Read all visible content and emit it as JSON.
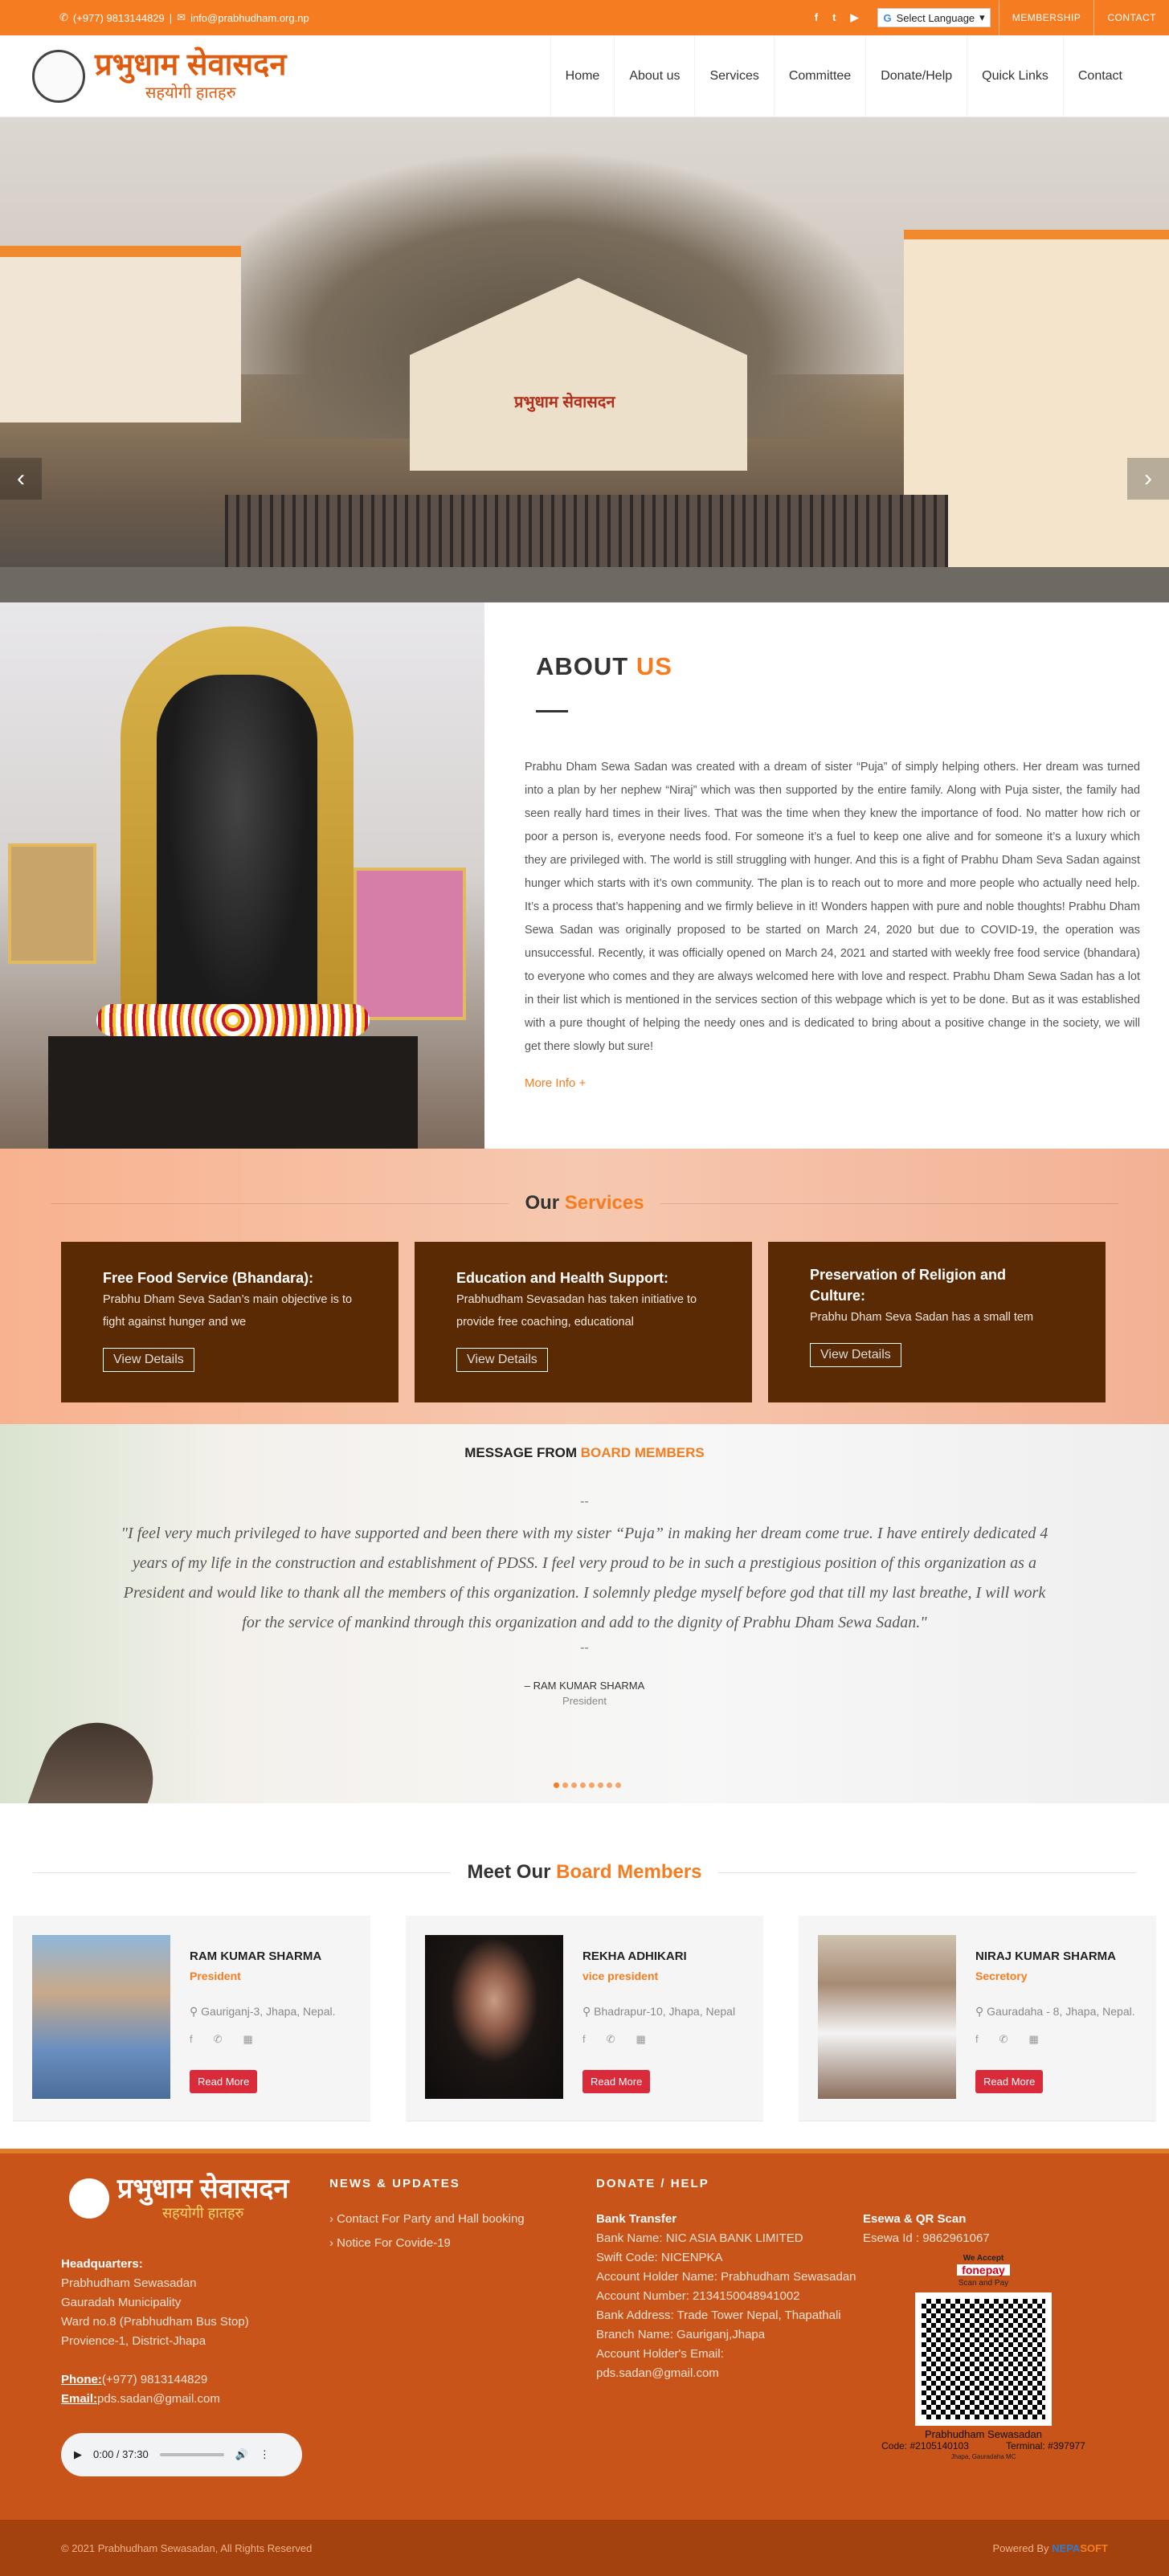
{
  "topbar": {
    "phone": "(+977) 9813144829",
    "email": "info@prabhudham.org.np",
    "language": "Select Language",
    "membership": "MEMBERSHIP",
    "contact": "CONTACT",
    "social": [
      "f",
      "t",
      "▶"
    ]
  },
  "header": {
    "logo_title": "प्रभुधाम सेवासदन",
    "logo_sub": "सहयोगी हातहरु",
    "logo_seal": "seal",
    "nav": [
      "Home",
      "About us",
      "Services",
      "Committee",
      "Donate/Help",
      "Quick Links",
      "Contact"
    ]
  },
  "hero": {
    "gate_text": "प्रभुधाम सेवासदन",
    "prev": "‹",
    "next": "›"
  },
  "about": {
    "title_a": "ABOUT",
    "title_b": "US",
    "body": "Prabhu Dham Sewa Sadan was created with a dream of sister “Puja” of simply helping others. Her dream was turned into a plan by her nephew “Niraj” which was then supported by the entire family. Along with Puja sister, the family had seen really hard times in their lives. That was the time when they knew the importance of food. No matter how rich or poor a person is, everyone needs food. For someone it’s a fuel to keep one alive and for someone it’s a luxury which they are privileged with. The world is still struggling with hunger. And this is a fight of Prabhu Dham Seva Sadan against hunger which starts with it’s own community. The plan is to reach out to more and more people who actually need help. It’s a process that’s happening and we firmly believe in it! Wonders happen with pure and noble thoughts! Prabhu Dham Sewa Sadan was originally proposed to be started on March 24, 2020 but due to COVID-19, the operation was unsuccessful. Recently, it was officially opened on March 24, 2021 and started with weekly free food service (bhandara) to everyone who comes and they are always welcomed here with love and respect. Prabhu Dham Sewa Sadan has a lot in their list which is mentioned in the services section of this webpage which is yet to be done. But as it was established with a pure thought of helping the needy ones and is dedicated to bring about a positive change in the society, we will get there slowly but sure!",
    "more": "More Info +"
  },
  "services": {
    "title_a": "Our",
    "title_b": "Services",
    "cards": [
      {
        "title": "Free Food Service (Bhandara):",
        "text": "Prabhu Dham Seva Sadan’s main objective is to fight against hunger and we",
        "btn": "View Details"
      },
      {
        "title": "Education and Health Support:",
        "text": "Prabhudham Sevasadan has taken initiative to provide free coaching, educational",
        "btn": "View Details"
      },
      {
        "title": "Preservation of Religion and Culture:",
        "text": "Prabhu Dham Seva Sadan has a small tem",
        "btn": "View Details"
      }
    ]
  },
  "message": {
    "title_a": "MESSAGE FROM",
    "title_b": "BOARD MEMBERS",
    "dash": "--",
    "quote": "\"I feel very much privileged to have supported and been there with my sister “Puja” in making her dream come true. I have entirely dedicated 4 years of my life in the construction and establishment of PDSS. I feel very proud to be in such a prestigious position of this organization as a President and would like to thank all the members of this organization. I solemnly pledge myself before god that till my last breathe, I will work for the service of mankind through this organization and add to the dignity of Prabhu Dham Sewa Sadan.\"",
    "author": "– RAM KUMAR SHARMA",
    "role": "President"
  },
  "board": {
    "title_a": "Meet Our",
    "title_b": "Board Members",
    "members": [
      {
        "name": "RAM KUMAR SHARMA",
        "post": "President",
        "addr": "Gauriganj-3, Jhapa, Nepal.",
        "btn": "Read More",
        "photo_color": "#6a8fbf"
      },
      {
        "name": "REKHA ADHIKARI",
        "post": "vice president",
        "addr": "Bhadrapur-10, Jhapa, Nepal",
        "btn": "Read More",
        "photo_color": "#1c1614"
      },
      {
        "name": "NIRAJ KUMAR SHARMA",
        "post": "Secretory",
        "addr": "Gauradaha - 8, Jhapa, Nepal.",
        "btn": "Read More",
        "photo_color": "#8b6f5e"
      }
    ]
  },
  "footer": {
    "logo_title": "प्रभुधाम सेवासदन",
    "logo_sub": "सहयोगी हातहरु",
    "hq_label": "Headquarters:",
    "hq": [
      "Prabhudham Sewasadan",
      "Gauradah Municipality",
      "Ward no.8 (Prabhudham Bus Stop)",
      "Provience-1, District-Jhapa"
    ],
    "phone_label": "Phone:",
    "phone": "(+977) 9813144829",
    "email_label": "Email:",
    "email": "pds.sadan@gmail.com",
    "audio_time": "0:00 / 37:30",
    "news_title": "NEWS & UPDATES",
    "news": [
      "Contact For Party and Hall booking",
      "Notice For Covide-19"
    ],
    "donate_title": "DONATE / HELP",
    "bank_title": "Bank Transfer",
    "bank": [
      "Bank Name: NIC ASIA BANK LIMITED",
      "Swift Code: NICENPKA",
      "Account Holder Name: Prabhudham Sewasadan",
      "Account Number: 2134150048941002",
      "Bank Address: Trade Tower Nepal, Thapathali",
      "Branch Name: Gauriganj,Jhapa",
      "Account Holder's Email:",
      "pds.sadan@gmail.com"
    ],
    "esewa_title": "Esewa & QR Scan",
    "esewa": "Esewa Id : 9862961067",
    "qr_accept": "We Accept",
    "qr_brand": "fonepay",
    "qr_sub": "Scan and Pay",
    "qr_name": "Prabhudham Sewasadan",
    "qr_code": "Code: #2105140103",
    "qr_terminal": "Terminal: #397977",
    "qr_loc": "Jhapa, Gauradaha MC"
  },
  "bottom": {
    "copyright": "© 2021 Prabhudham Sewasadan, All Rights Reserved",
    "powered": "Powered By",
    "brand_a": "NEPA",
    "brand_b": "SOFT"
  }
}
